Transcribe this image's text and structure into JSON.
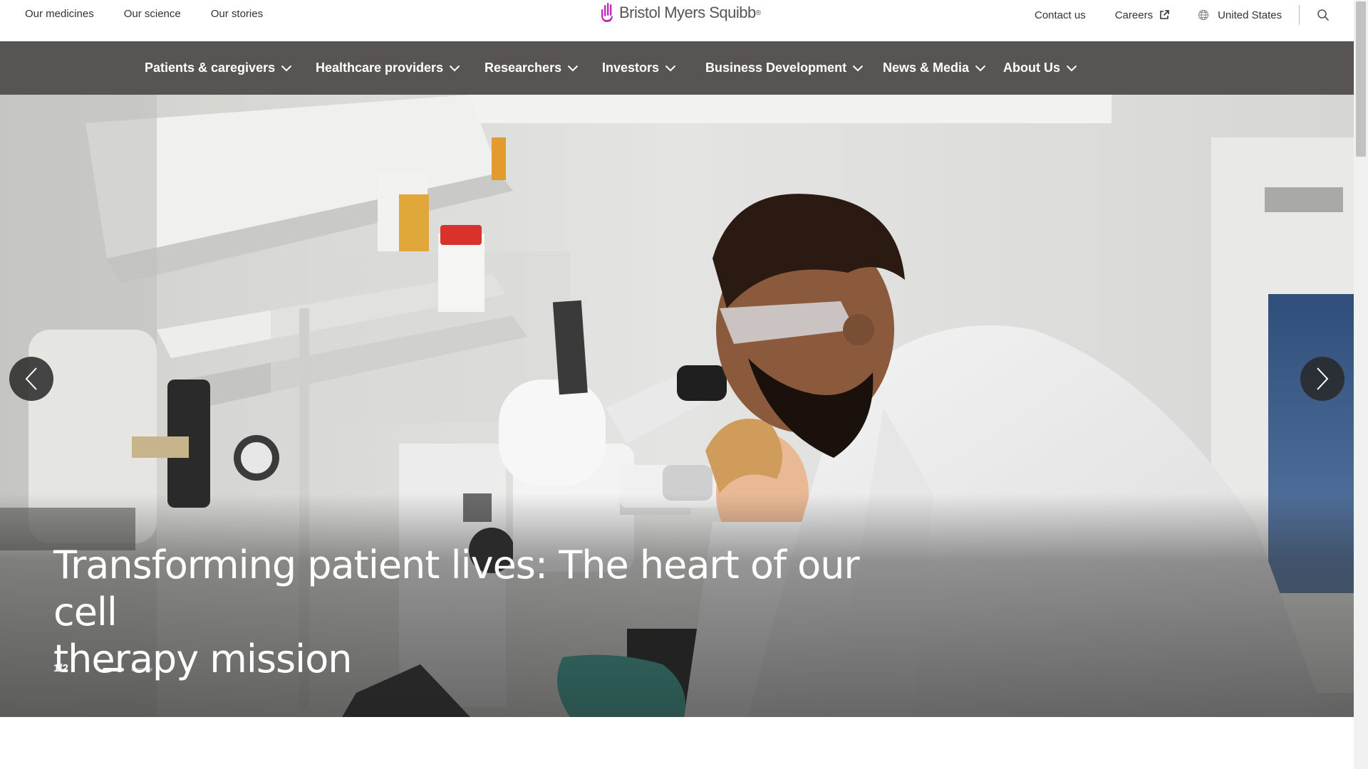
{
  "utility_nav": {
    "links": [
      "Our medicines",
      "Our science",
      "Our stories"
    ],
    "contact_label": "Contact us",
    "careers_label": "Careers",
    "region_label": "United States"
  },
  "logo": {
    "text": "Bristol Myers Squibb",
    "registered_mark": "®",
    "brand_color": "#BE2BBB"
  },
  "main_nav": {
    "background": "#595454",
    "items": [
      {
        "label": "Patients & caregivers"
      },
      {
        "label": "Healthcare providers"
      },
      {
        "label": "Researchers"
      },
      {
        "label": "Investors"
      },
      {
        "label": "Business Development"
      },
      {
        "label": "News & Media"
      },
      {
        "label": "About Us"
      }
    ]
  },
  "hero": {
    "title_line1": "Transforming patient lives: The heart of our cell",
    "title_line2": "therapy mission",
    "slide_counter": "1/2",
    "current_slide": 1,
    "total_slides": 2,
    "prev_icon": "chevron-left-icon",
    "next_icon": "chevron-right-icon"
  },
  "icons": {
    "careers": "external-link-icon",
    "region": "globe-icon",
    "search": "search-icon",
    "nav_dropdown": "chevron-down-icon"
  }
}
